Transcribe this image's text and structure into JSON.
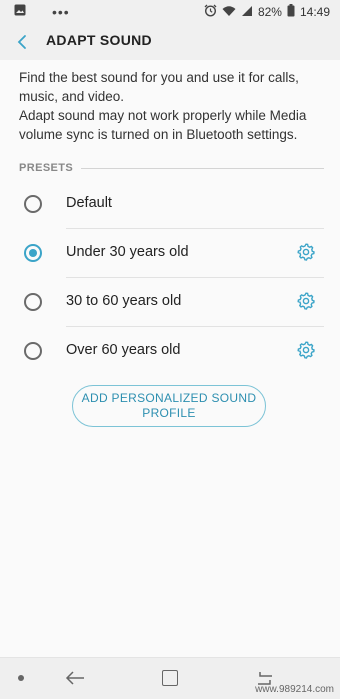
{
  "status_bar": {
    "battery_percent": "82%",
    "time": "14:49",
    "icons": [
      "image-icon",
      "more-dots-icon",
      "alarm-icon",
      "wifi-icon",
      "signal-icon",
      "battery-icon"
    ]
  },
  "app_bar": {
    "title": "ADAPT SOUND"
  },
  "description": {
    "line1": "Find the best sound for you and use it for calls, music, and video.",
    "line2": "Adapt sound may not work properly while Media volume sync is turned on in Bluetooth settings."
  },
  "presets": {
    "header": "PRESETS",
    "items": [
      {
        "label": "Default",
        "selected": false,
        "has_settings": false
      },
      {
        "label": "Under 30 years old",
        "selected": true,
        "has_settings": true
      },
      {
        "label": "30 to 60 years old",
        "selected": false,
        "has_settings": true
      },
      {
        "label": "Over 60 years old",
        "selected": false,
        "has_settings": true
      }
    ]
  },
  "add_button": {
    "line1": "ADD PERSONALIZED SOUND",
    "line2": "PROFILE"
  },
  "watermark": "www.989214.com",
  "colors": {
    "accent": "#3ba4c8",
    "button_text": "#2d8fb0",
    "background": "#fafafa"
  }
}
